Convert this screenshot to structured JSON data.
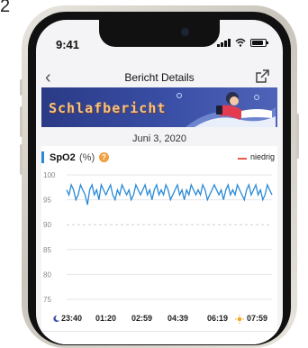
{
  "corner_label": "2",
  "status_bar": {
    "time": "9:41"
  },
  "nav": {
    "title": "Bericht Details"
  },
  "banner": {
    "title": "Schlafbericht"
  },
  "report": {
    "date": "Juni 3, 2020"
  },
  "chart_header": {
    "metric": "SpO2",
    "unit": "(%)",
    "legend_low": "niedrig"
  },
  "colors": {
    "series": "#2a8ad6",
    "low": "#e85a4a",
    "banner": "#34479e"
  },
  "chart_data": {
    "type": "line",
    "ylim": [
      75,
      100
    ],
    "yticks": [
      "100",
      "95",
      "90",
      "85",
      "80",
      "75"
    ],
    "x_labels": [
      "23:40",
      "01:20",
      "02:59",
      "04:39",
      "06:19",
      "07:59"
    ],
    "series": [
      {
        "values": [
          97,
          96,
          98,
          97,
          95,
          96,
          98,
          97,
          96,
          94,
          97,
          98,
          96,
          97,
          95,
          98,
          97,
          96,
          97,
          98,
          96,
          95,
          97,
          96,
          98,
          97,
          96,
          97,
          95,
          96,
          98,
          97,
          96,
          97,
          98,
          96,
          97,
          95,
          97,
          98,
          96,
          97,
          96,
          98,
          97,
          95,
          96,
          97,
          98,
          96,
          97,
          95,
          97,
          96,
          98,
          97,
          96,
          97,
          96,
          98,
          97,
          95,
          96,
          97,
          98,
          97,
          96,
          97,
          95,
          97,
          98,
          96,
          97,
          96,
          98,
          97,
          96,
          95,
          97,
          98,
          96,
          97,
          98,
          96,
          97,
          95,
          96,
          98,
          97,
          96
        ]
      }
    ]
  }
}
